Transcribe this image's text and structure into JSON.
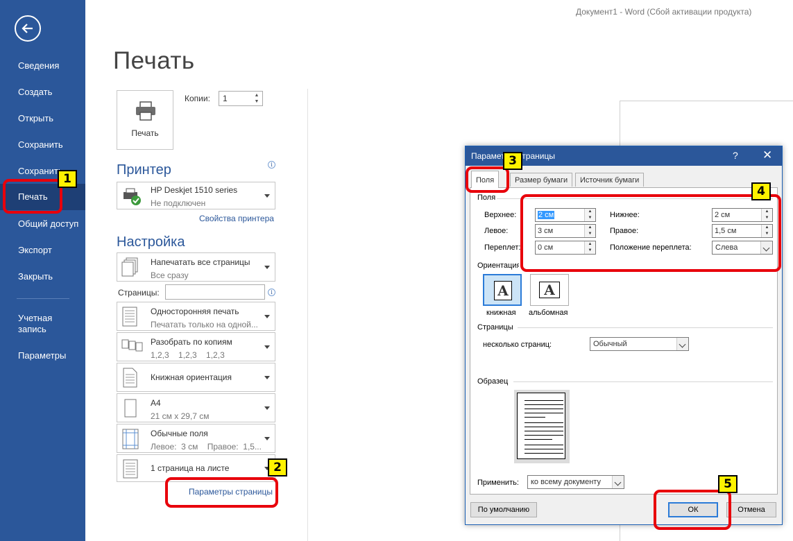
{
  "window": {
    "title": "Документ1 - Word (Сбой активации продукта)"
  },
  "nav": {
    "items": [
      {
        "label": "Сведения",
        "active": false
      },
      {
        "label": "Создать",
        "active": false
      },
      {
        "label": "Открыть",
        "active": false
      },
      {
        "label": "Сохранить",
        "active": false
      },
      {
        "label": "Сохранить",
        "active": false
      },
      {
        "label": "Печать",
        "active": true
      },
      {
        "label": "Общий доступ",
        "active": false
      },
      {
        "label": "Экспорт",
        "active": false
      },
      {
        "label": "Закрыть",
        "active": false
      }
    ],
    "account_line1": "Учетная",
    "account_line2": "запись",
    "options": "Параметры"
  },
  "print": {
    "title": "Печать",
    "print_button": "Печать",
    "copies_label": "Копии:",
    "copies_value": "1"
  },
  "printer": {
    "section_title": "Принтер",
    "name": "HP Deskjet 1510 series",
    "status": "Не подключен",
    "properties_link": "Свойства принтера"
  },
  "settings": {
    "section_title": "Настройка",
    "pages_label": "Страницы:",
    "pages_value": "",
    "dropdowns": [
      {
        "title": "Напечатать все страницы",
        "subtitle": "Все сразу"
      },
      {
        "title": "Односторонняя печать",
        "subtitle": "Печатать только на одной..."
      },
      {
        "title": "Разобрать по копиям",
        "subtitle": "1,2,3    1,2,3    1,2,3"
      },
      {
        "title": "Книжная ориентация",
        "subtitle": ""
      },
      {
        "title": "A4",
        "subtitle": "21 см x 29,7 см"
      },
      {
        "title": "Обычные поля",
        "subtitle": "Левое:  3 см    Правое:  1,5..."
      },
      {
        "title": "1 страница на листе",
        "subtitle": ""
      }
    ],
    "page_setup_link": "Параметры страницы"
  },
  "dialog": {
    "title": "Параметры страницы",
    "help": "?",
    "close": "✕",
    "tabs": [
      "Поля",
      "Размер бумаги",
      "Источник бумаги"
    ],
    "margins_group": "Поля",
    "top_label": "Верхнее:",
    "top_value": "2 см",
    "bottom_label": "Нижнее:",
    "bottom_value": "2 см",
    "left_label": "Левое:",
    "left_value": "3 см",
    "right_label": "Правое:",
    "right_value": "1,5 см",
    "gutter_label": "Переплет:",
    "gutter_value": "0 см",
    "gutter_pos_label": "Положение переплета:",
    "gutter_pos_value": "Слева",
    "orientation_group": "Ориентация",
    "portrait": "книжная",
    "landscape": "альбомная",
    "pages_group": "Страницы",
    "multiple_pages_label": "несколько страниц:",
    "multiple_pages_value": "Обычный",
    "sample_group": "Образец",
    "apply_label": "Применить:",
    "apply_value": "ко всему документу",
    "default_button": "По умолчанию",
    "ok_button": "ОК",
    "cancel_button": "Отмена"
  },
  "callouts": [
    "1",
    "2",
    "3",
    "4",
    "5"
  ],
  "colors": {
    "accent": "#2b579a",
    "highlight": "#e8000b",
    "badge": "#fff200"
  }
}
